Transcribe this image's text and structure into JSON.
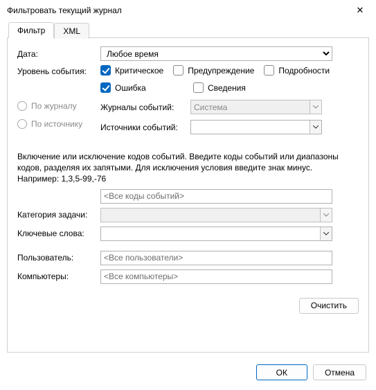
{
  "window": {
    "title": "Фильтровать текущий журнал"
  },
  "tabs": {
    "filter": "Фильтр",
    "xml": "XML"
  },
  "labels": {
    "date": "Дата:",
    "level": "Уровень события:",
    "by_log": "По журналу",
    "by_source": "По источнику",
    "event_logs": "Журналы событий:",
    "event_sources": "Источники событий:",
    "hint": "Включение или исключение кодов событий. Введите коды событий или диапазоны кодов, разделяя их запятыми. Для исключения условия введите знак минус. Например: 1,3,5-99,-76",
    "task_category": "Категория задачи:",
    "keywords": "Ключевые слова:",
    "user": "Пользователь:",
    "computers": "Компьютеры:"
  },
  "levels": {
    "critical": "Критическое",
    "warning": "Предупреждение",
    "verbose": "Подробности",
    "error": "Ошибка",
    "information": "Сведения"
  },
  "values": {
    "date": "Любое время",
    "event_logs": "Система",
    "event_sources": "",
    "event_ids": "<Все коды событий>",
    "task_category": "",
    "keywords": "",
    "user": "<Все пользователи>",
    "computers": "<Все компьютеры>"
  },
  "buttons": {
    "clear": "Очистить",
    "ok": "ОК",
    "cancel": "Отмена"
  }
}
